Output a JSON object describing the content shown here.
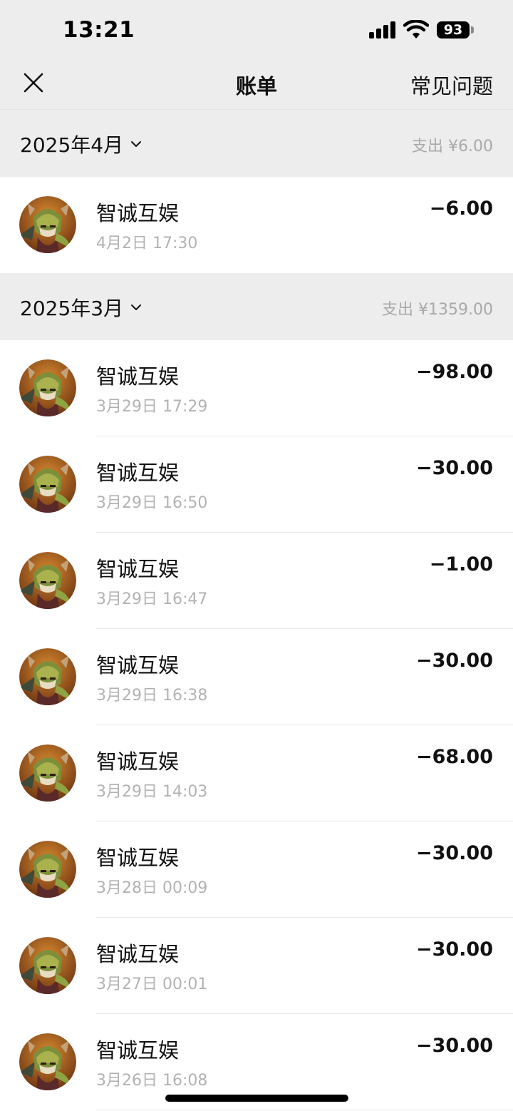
{
  "status_bar": {
    "time": "13:21",
    "battery": "93"
  },
  "nav": {
    "title": "账单",
    "faq": "常见问题"
  },
  "colors": {
    "background": "#ededed",
    "text": "#111111",
    "secondary": "#b2b2b2"
  },
  "months": [
    {
      "label": "2025年4月",
      "summary": "支出 ¥6.00",
      "transactions": [
        {
          "merchant": "智诚互娱",
          "time": "4月2日 17:30",
          "amount": "−6.00"
        }
      ]
    },
    {
      "label": "2025年3月",
      "summary": "支出 ¥1359.00",
      "transactions": [
        {
          "merchant": "智诚互娱",
          "time": "3月29日 17:29",
          "amount": "−98.00"
        },
        {
          "merchant": "智诚互娱",
          "time": "3月29日 16:50",
          "amount": "−30.00"
        },
        {
          "merchant": "智诚互娱",
          "time": "3月29日 16:47",
          "amount": "−1.00"
        },
        {
          "merchant": "智诚互娱",
          "time": "3月29日 16:38",
          "amount": "−30.00"
        },
        {
          "merchant": "智诚互娱",
          "time": "3月29日 14:03",
          "amount": "−68.00"
        },
        {
          "merchant": "智诚互娱",
          "time": "3月28日 00:09",
          "amount": "−30.00"
        },
        {
          "merchant": "智诚互娱",
          "time": "3月27日 00:01",
          "amount": "−30.00"
        },
        {
          "merchant": "智诚互娱",
          "time": "3月26日 16:08",
          "amount": "−30.00"
        }
      ]
    }
  ]
}
